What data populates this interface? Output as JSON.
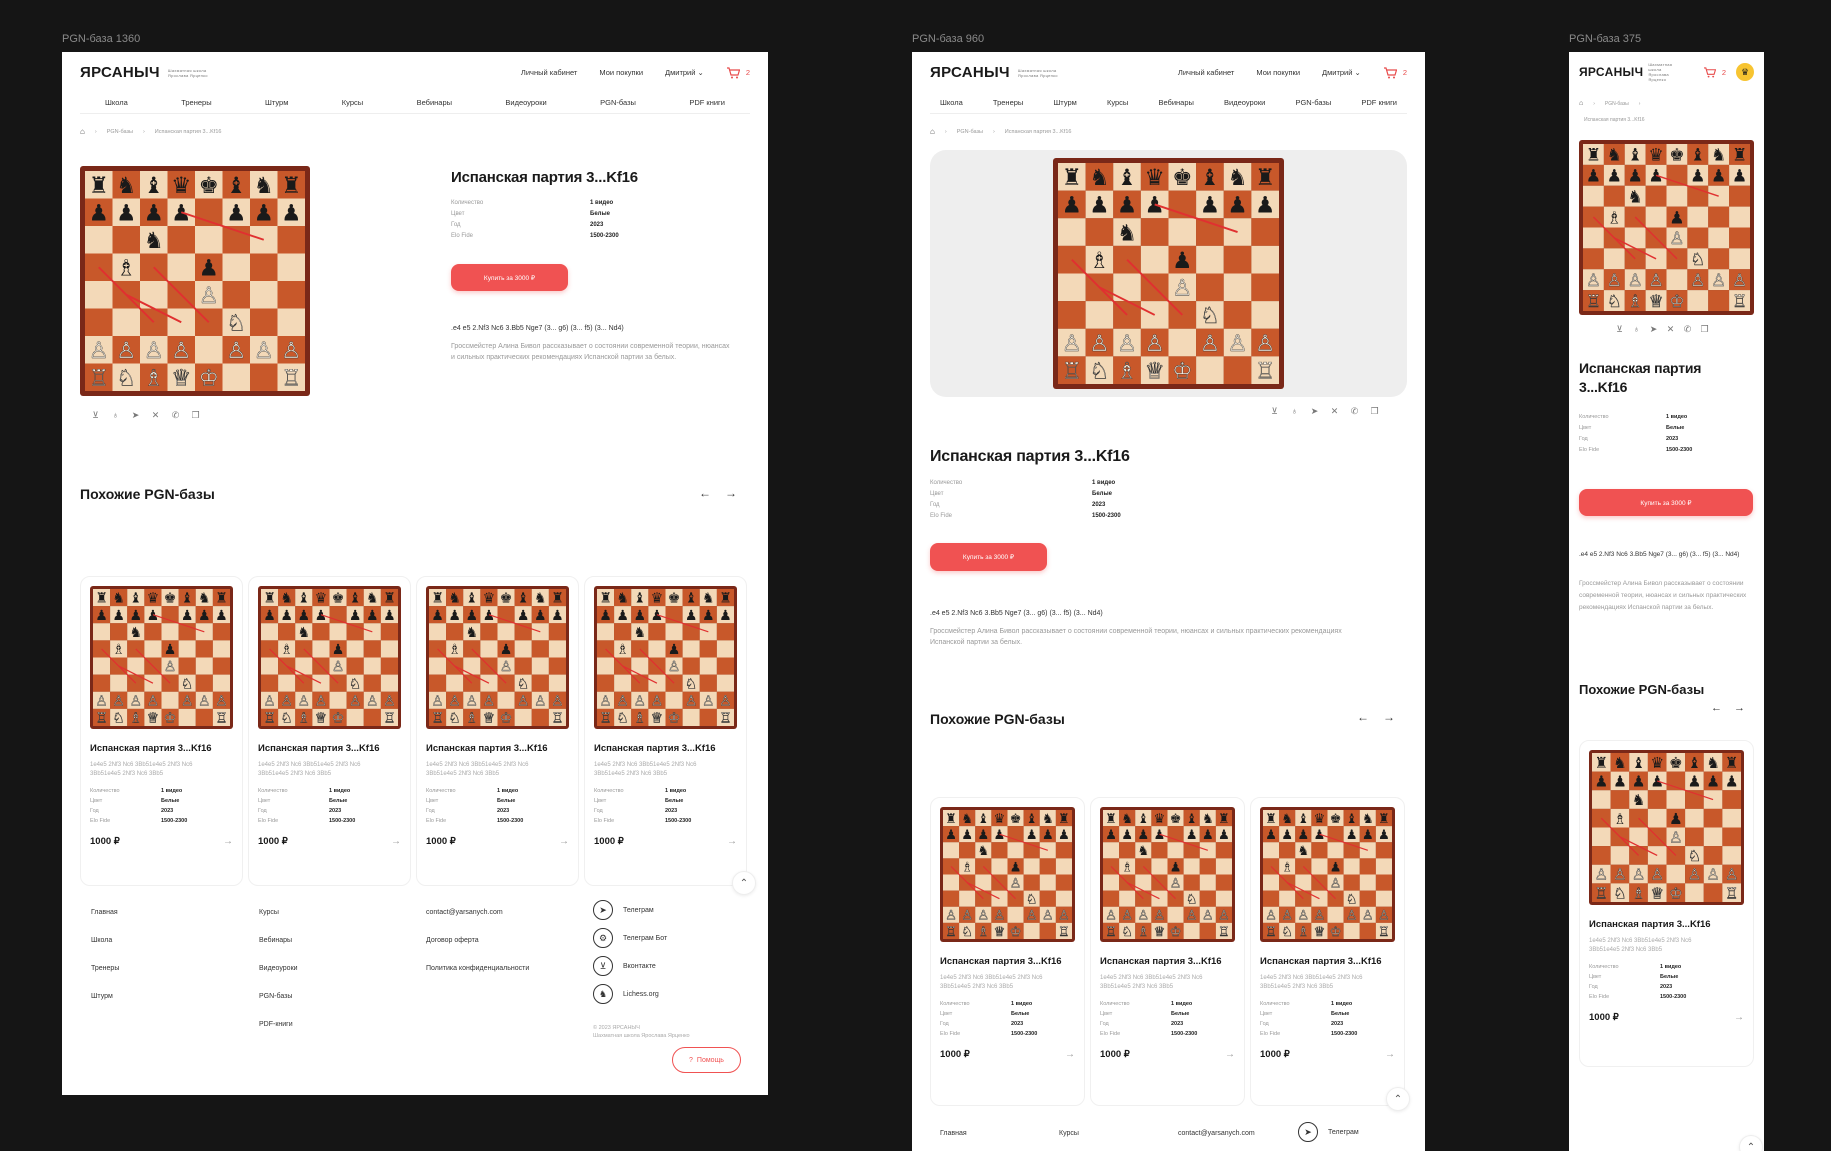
{
  "frames": {
    "desktop_label": "PGN-база 1360",
    "tablet_label": "PGN-база 960",
    "mobile_label": "PGN-база 375"
  },
  "header": {
    "logo": "ЯРСАНЫЧ",
    "logo_sub": "Шахматная школа Ярослава Ярценко",
    "cabinet": "Личный кабинет",
    "purchases": "Мои покупки",
    "user": "Дмитрий",
    "cart_count": "2"
  },
  "menu": [
    "Школа",
    "Тренеры",
    "Штурм",
    "Курсы",
    "Вебинары",
    "Видеоуроки",
    "PGN-базы",
    "PDF книги"
  ],
  "breadcrumb": {
    "section": "PGN-базы",
    "current": "Испанская партия 3...Kf16"
  },
  "product": {
    "title": "Испанская партия 3...Kf16",
    "props": [
      {
        "k": "Количество",
        "v": "1 видео"
      },
      {
        "k": "Цвет",
        "v": "Белые"
      },
      {
        "k": "Год",
        "v": "2023"
      },
      {
        "k": "Elo Fide",
        "v": "1500-2300"
      }
    ],
    "buy": "Купить за 3000 ₽",
    "moves": ".e4 e5 2.Nf3 Nc6 3.Bb5 Nge7 (3... g6) (3... f5) (3... Nd4)",
    "description": "Гроссмейстер Алина Бивол рассказывает о состоянии современной теории, нюансах и сильных практических рекомендациях Испанской партии за белых."
  },
  "similar": {
    "title": "Похожие PGN-базы",
    "card": {
      "title": "Испанская партия 3...Kf16",
      "moves": "1e4e5 2Nf3 Nc6 3Bb51e4e5 2Nf3 Nc6 3Bb51e4e5 2Nf3 Nc6 3Bb5",
      "price": "1000 ₽"
    }
  },
  "footer": {
    "col1": [
      "Главная",
      "Школа",
      "Тренеры",
      "Штурм"
    ],
    "col2": [
      "Курсы",
      "Вебинары",
      "Видеоуроки",
      "PGN-базы",
      "PDF-книги"
    ],
    "col3": [
      "contact@yarsanych.com",
      "Договор оферта",
      "Политика конфиденциальности"
    ],
    "social": [
      "Телеграм",
      "Телеграм Бот",
      "Вконтакте",
      "Lichess.org"
    ],
    "copyright_1": "© 2023 ЯРСАНЫЧ",
    "copyright_2": "Шахматная школа Ярослава Ярценко",
    "help": "Помощь"
  },
  "colors": {
    "accent": "#f05252",
    "board_light": "#f3d9b8",
    "board_dark": "#c8582a",
    "board_frame": "#7a2818"
  }
}
